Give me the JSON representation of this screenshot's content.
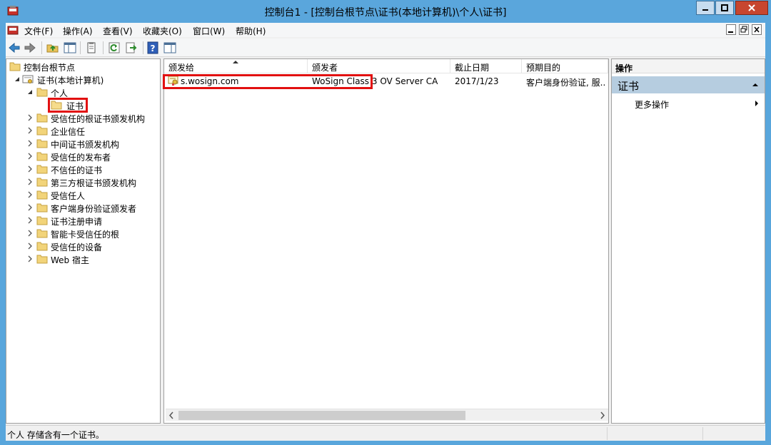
{
  "window": {
    "title": "控制台1 - [控制台根节点\\证书(本地计算机)\\个人\\证书]"
  },
  "menu": {
    "items": [
      "文件(F)",
      "操作(A)",
      "查看(V)",
      "收藏夹(O)",
      "窗口(W)",
      "帮助(H)"
    ]
  },
  "toolbar": {
    "buttons": [
      "back-icon",
      "forward-icon",
      "up-folder-icon",
      "show-tree-icon",
      "properties-icon",
      "refresh-icon",
      "export-icon",
      "help-icon",
      "action-pane-icon"
    ]
  },
  "tree": {
    "root": "控制台根节点",
    "store": "证书(本地计算机)",
    "personal": "个人",
    "certificates": "证书",
    "others": [
      "受信任的根证书颁发机构",
      "企业信任",
      "中间证书颁发机构",
      "受信任的发布者",
      "不信任的证书",
      "第三方根证书颁发机构",
      "受信任人",
      "客户端身份验证颁发者",
      "证书注册申请",
      "智能卡受信任的根",
      "受信任的设备",
      "Web 宿主"
    ]
  },
  "list": {
    "columns": [
      "颁发给",
      "颁发者",
      "截止日期",
      "预期目的"
    ],
    "rows": [
      {
        "issued_to": "s.wosign.com",
        "issued_by": "WoSign Class 3 OV Server CA",
        "expires": "2017/1/23",
        "purpose": "客户端身份验证, 服..."
      }
    ]
  },
  "actions": {
    "header": "操作",
    "section": "证书",
    "more": "更多操作"
  },
  "status": {
    "text": "个人 存储含有一个证书。"
  },
  "colors": {
    "title_bar": "#5aa6dc",
    "highlight": "#e21010",
    "action_section": "#b6cde0"
  }
}
